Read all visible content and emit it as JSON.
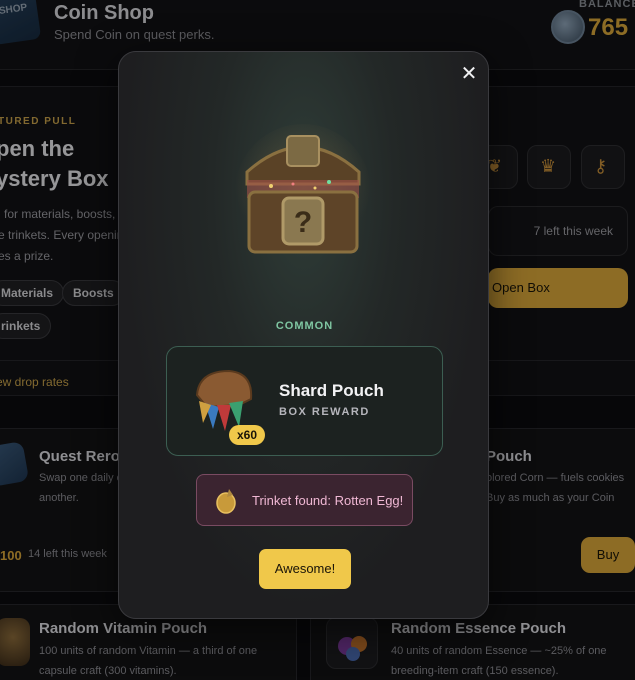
{
  "header": {
    "logo_text": "SHOP",
    "title": "Coin Shop",
    "subtitle": "Spend Coin on quest perks.",
    "balance_label": "BALANCE",
    "balance_value": "765"
  },
  "featured": {
    "kicker": "TURED PULL",
    "title_line1": "pen the",
    "title_line2": "ystery Box",
    "desc_line1": "l for materials, boosts,",
    "desc_line2": "e trinkets. Every openin",
    "desc_line3": "es a prize.",
    "chips": [
      "Materials",
      "Boosts",
      "rinkets"
    ],
    "link": "ew drop rates",
    "stock": "7 left this week",
    "open_button": "Open Box"
  },
  "cards": {
    "quest_reroll": {
      "title": "Quest Reroll",
      "desc_line1": "Swap one daily o",
      "desc_line2": "another.",
      "price": "100",
      "stock": "14 left this week"
    },
    "corn_pouch": {
      "title": "Pouch",
      "desc_line1": "olored Corn — fuels cookies",
      "desc_line2": "Buy as much as your Coin",
      "buy_button": "Buy"
    },
    "vitamin_pouch": {
      "title": "Random Vitamin Pouch",
      "desc_line1": "100 units of random Vitamin — a third of one",
      "desc_line2": "capsule craft (300 vitamins)."
    },
    "essence_pouch": {
      "title": "Random Essence Pouch",
      "desc_line1": "40 units of random Essence — ~25% of one",
      "desc_line2": "breeding-item craft (150 essence)."
    }
  },
  "modal": {
    "close_symbol": "✕",
    "rarity": "COMMON",
    "reward": {
      "quantity": "x60",
      "name": "Shard Pouch",
      "type": "BOX REWARD"
    },
    "trinket_message": "Trinket found: Rotten Egg!",
    "confirm_button": "Awesome!"
  },
  "colors": {
    "accent_gold": "#d9a73a",
    "button_gold": "#f0c84a",
    "rarity_common": "#7fc6a2",
    "trinket_pink": "#f0b8d4"
  }
}
